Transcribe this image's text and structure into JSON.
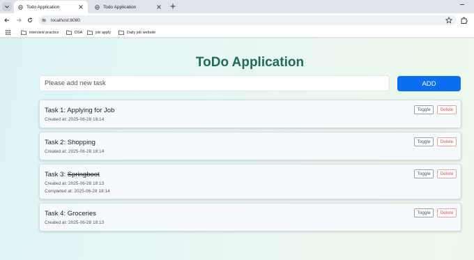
{
  "browser": {
    "tabs": [
      {
        "title": "Todo Application",
        "active": true
      },
      {
        "title": "Todo Application",
        "active": false
      }
    ],
    "url": "localhost:8080",
    "bookmarks": [
      "interview practice",
      "DSA",
      "job apply",
      "Daily job website"
    ]
  },
  "app": {
    "title": "ToDo Application",
    "input_placeholder": "Please add new task",
    "add_label": "ADD",
    "toggle_label": "Toggle",
    "delete_label": "Delete",
    "tasks": [
      {
        "prefix": "Task 1: ",
        "name": "Applying for Job",
        "completed": false,
        "created": "Created at: 2025-06-28 18:14",
        "completed_at": ""
      },
      {
        "prefix": "Task 2: ",
        "name": "Shopping",
        "completed": false,
        "created": "Created at: 2025-06-28 18:14",
        "completed_at": ""
      },
      {
        "prefix": "Task 3: ",
        "name": "Springboot",
        "completed": true,
        "created": "Created at: 2025-06-28 18:13",
        "completed_at": "Completed at: 2025-06-28 18:14"
      },
      {
        "prefix": "Task 4: ",
        "name": "Groceries",
        "completed": false,
        "created": "Created at: 2025-06-28 18:13",
        "completed_at": ""
      }
    ]
  },
  "colors": {
    "title": "#1f6b5a",
    "add_button": "#0b6ef0",
    "delete_text": "#d9534f"
  }
}
